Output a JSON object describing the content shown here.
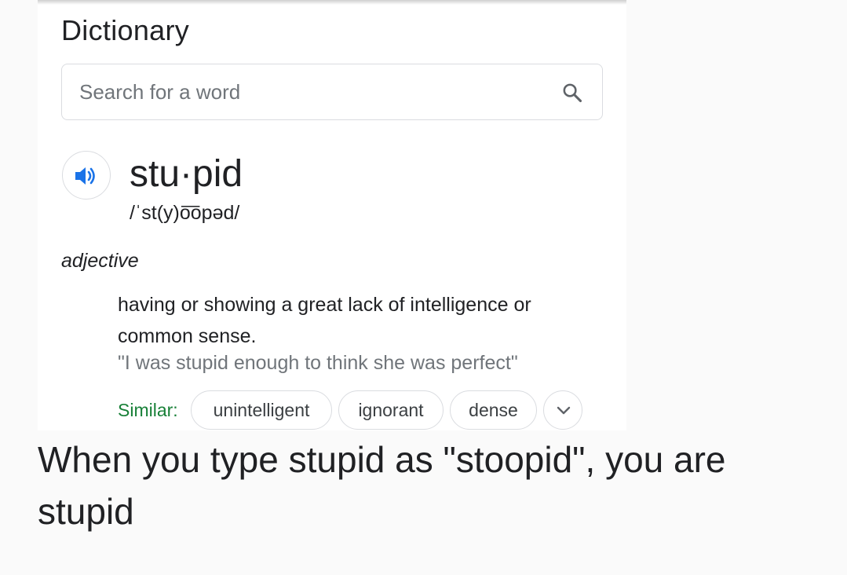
{
  "dictionary": {
    "title": "Dictionary",
    "search": {
      "placeholder": "Search for a word",
      "value": ""
    },
    "entry": {
      "headword": "stu·pid",
      "phonetic": "/ˈst(y)o͞opəd/",
      "part_of_speech": "adjective",
      "definition": "having or showing a great lack of intelligence or common sense.",
      "example": "\"I was stupid enough to think she was perfect\"",
      "similar_label": "Similar:",
      "similar_words": [
        "unintelligent",
        "ignorant",
        "dense"
      ]
    },
    "icons": {
      "search": "search-icon",
      "audio": "speaker-icon",
      "expand": "chevron-down-icon"
    },
    "colors": {
      "accent_blue": "#1a73e8",
      "similar_green": "#188038"
    }
  },
  "caption": "When you type stupid as \"stoopid\", you are stupid"
}
